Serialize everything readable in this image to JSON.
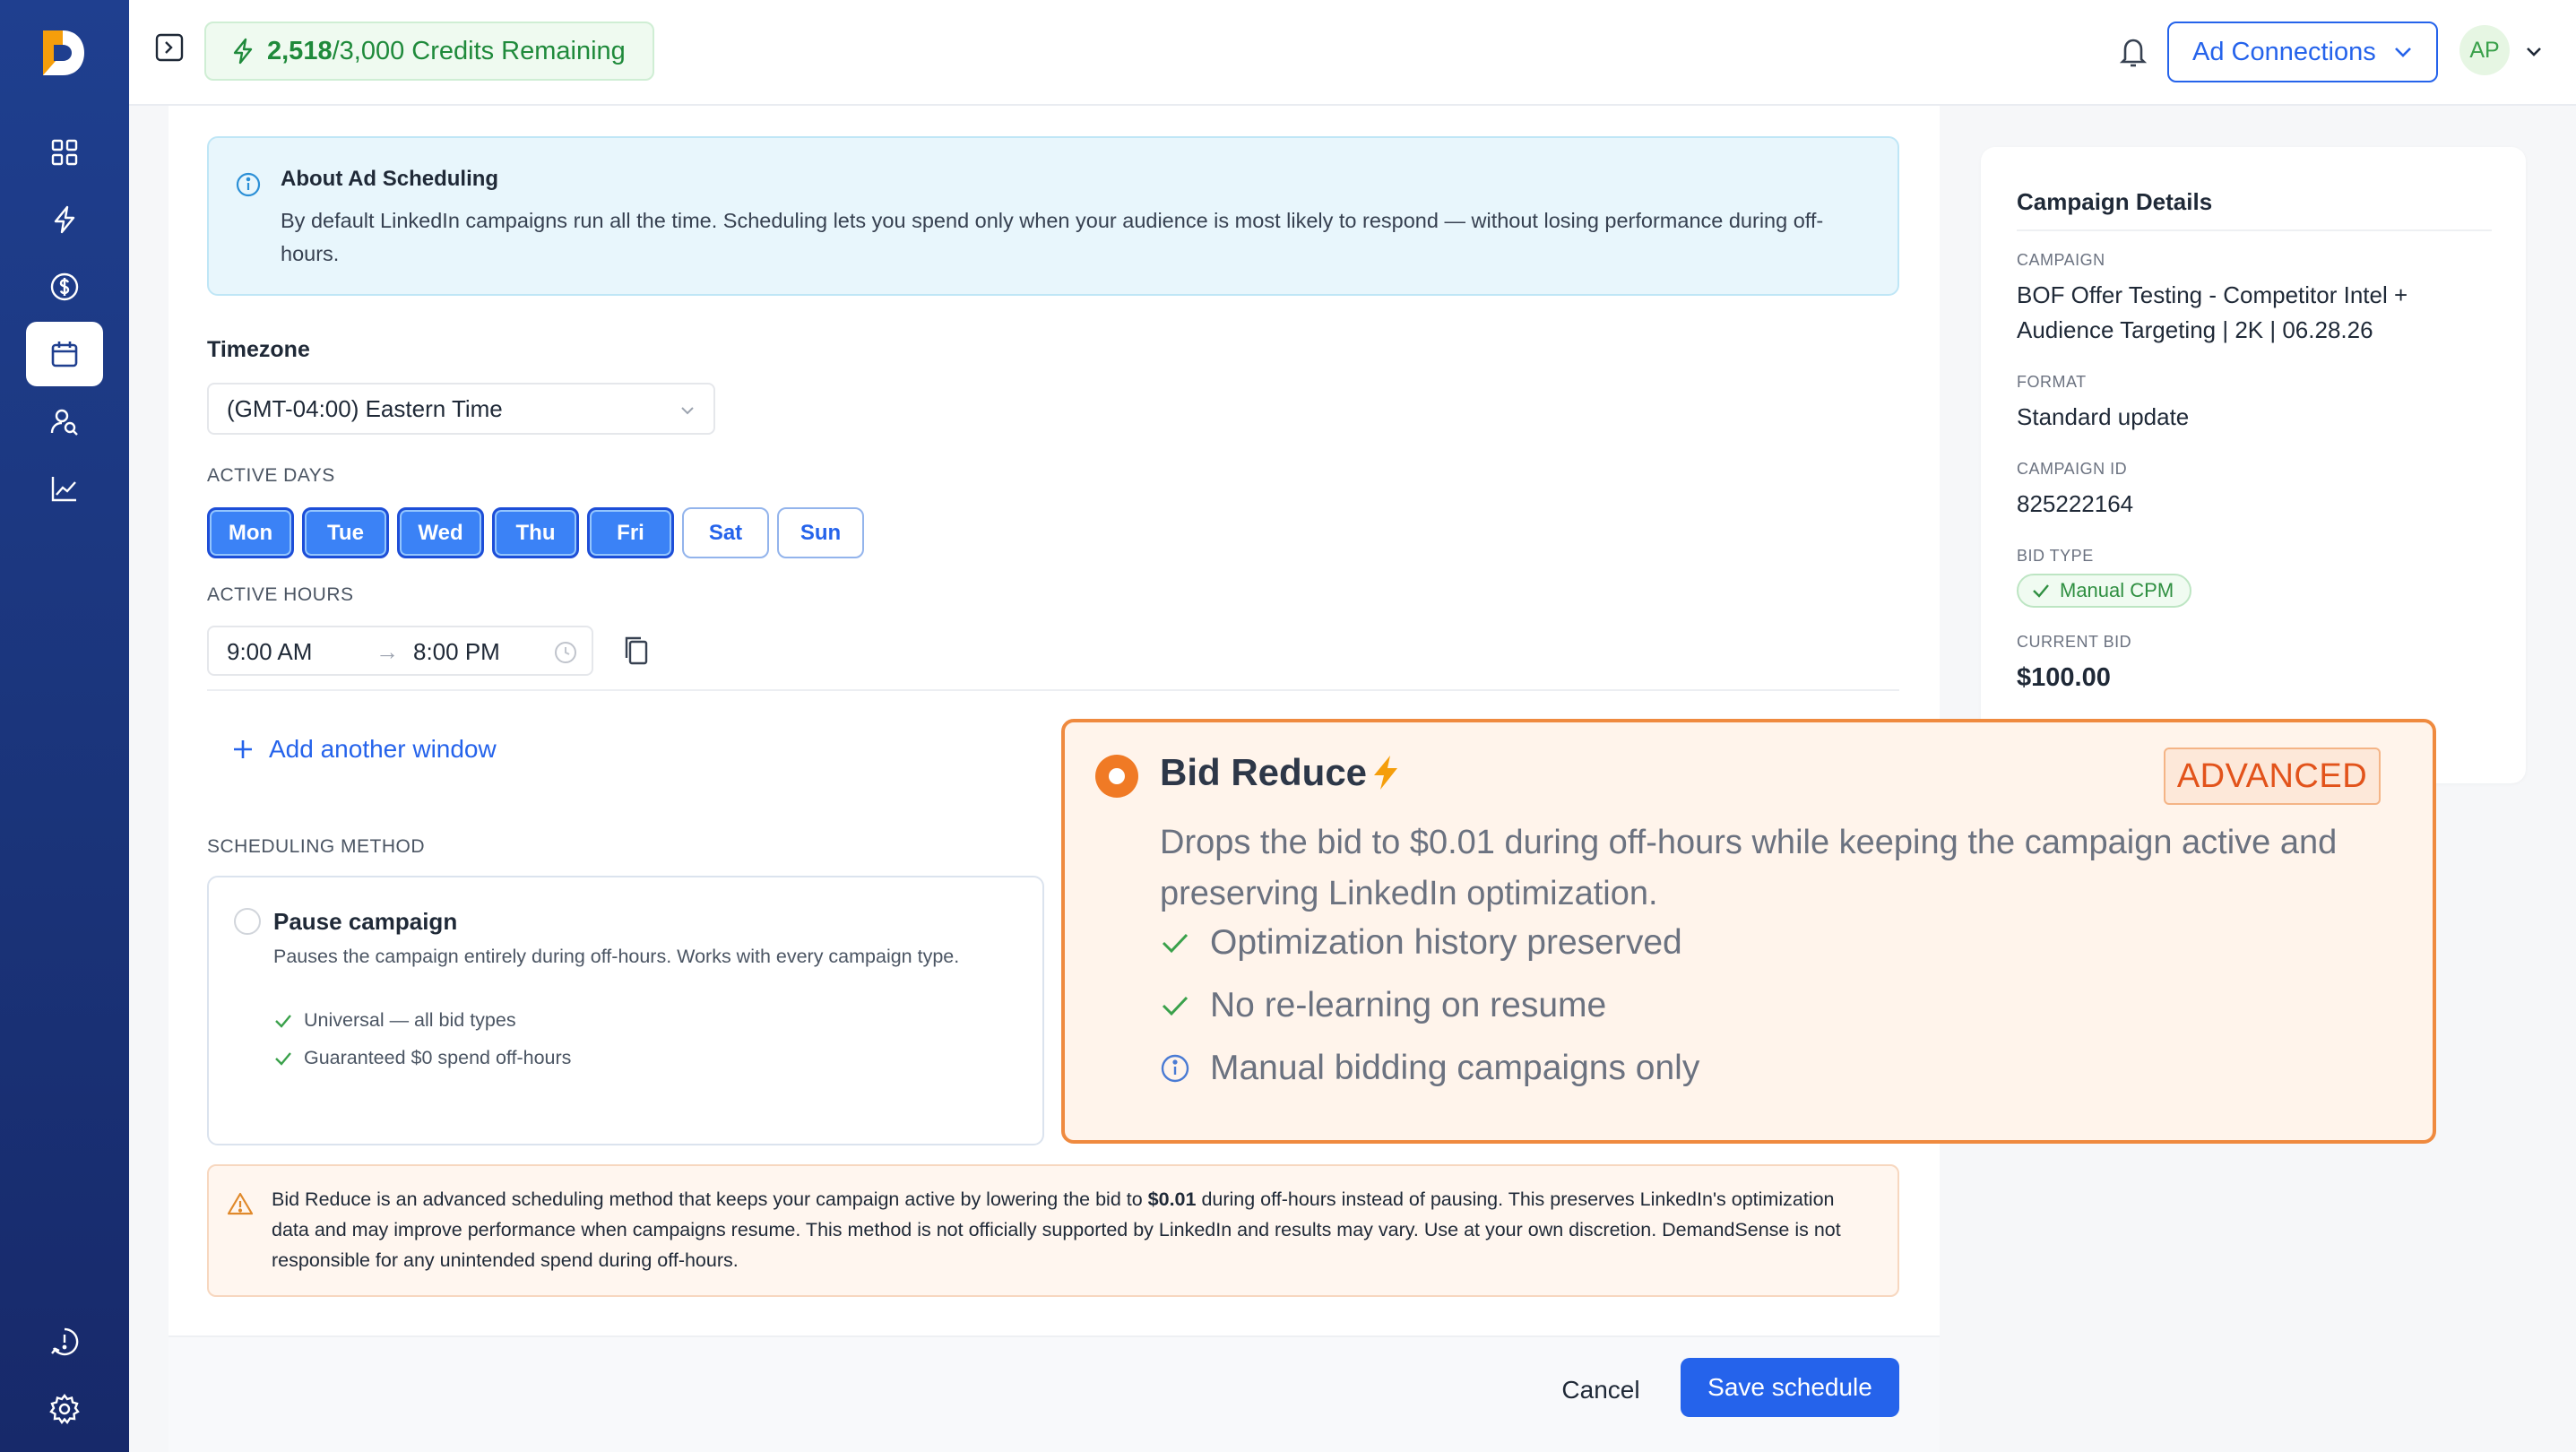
{
  "topbar": {
    "credits_used": "2,518",
    "credits_total": "/3,000 Credits Remaining",
    "ad_connections_label": "Ad Connections",
    "avatar_initials": "AP"
  },
  "info": {
    "title": "About Ad Scheduling",
    "text": "By default LinkedIn campaigns run all the time. Scheduling lets you spend only when your audience is most likely to respond — without losing performance during off-hours."
  },
  "timezone": {
    "label": "Timezone",
    "value": "(GMT-04:00) Eastern Time"
  },
  "active_days": {
    "label": "ACTIVE DAYS",
    "days": [
      {
        "label": "Mon",
        "active": true
      },
      {
        "label": "Tue",
        "active": true
      },
      {
        "label": "Wed",
        "active": true
      },
      {
        "label": "Thu",
        "active": true
      },
      {
        "label": "Fri",
        "active": true
      },
      {
        "label": "Sat",
        "active": false
      },
      {
        "label": "Sun",
        "active": false
      }
    ]
  },
  "active_hours": {
    "label": "ACTIVE HOURS",
    "start": "9:00 AM",
    "arrow": "→",
    "end": "8:00 PM"
  },
  "add_window_label": "Add another window",
  "scheduling_method": {
    "label": "SCHEDULING METHOD",
    "pause": {
      "title": "Pause campaign",
      "description": "Pauses the campaign entirely during off-hours. Works with every campaign type.",
      "points": [
        "Universal — all bid types",
        "Guaranteed $0 spend off-hours"
      ]
    }
  },
  "warning": {
    "text_before": "Bid Reduce is an advanced scheduling method that keeps your campaign active by lowering the bid to ",
    "text_bold": "$0.01",
    "text_after": " during off-hours instead of pausing. This preserves LinkedIn's optimization data and may improve performance when campaigns resume. This method is not officially supported by LinkedIn and results may vary. Use at your own discretion. DemandSense is not responsible for any unintended spend during off-hours."
  },
  "footer": {
    "cancel_label": "Cancel",
    "save_label": "Save schedule"
  },
  "campaign_details": {
    "title": "Campaign Details",
    "campaign_label": "CAMPAIGN",
    "campaign_value": "BOF Offer Testing - Competitor Intel + Audience Targeting | 2K | 06.28.26",
    "format_label": "FORMAT",
    "format_value": "Standard update",
    "id_label": "CAMPAIGN ID",
    "id_value": "825222164",
    "bid_type_label": "BID TYPE",
    "bid_type_value": "Manual CPM",
    "current_bid_label": "CURRENT BID",
    "current_bid_value": "$100.00"
  },
  "bid_reduce": {
    "title": "Bid Reduce",
    "badge": "ADVANCED",
    "description": "Drops the bid to $0.01 during off-hours while keeping the campaign active and preserving LinkedIn optimization.",
    "points": [
      {
        "text": "Optimization history preserved",
        "icon": "check-icon"
      },
      {
        "text": "No re-learning on resume",
        "icon": "check-icon"
      },
      {
        "text": "Manual bidding campaigns only",
        "icon": "info-icon"
      }
    ]
  },
  "colors": {
    "sidebar": "#1f3f8f",
    "primary": "#2563eb",
    "success": "#1f8a3b",
    "accent_orange": "#ef8a3f"
  }
}
